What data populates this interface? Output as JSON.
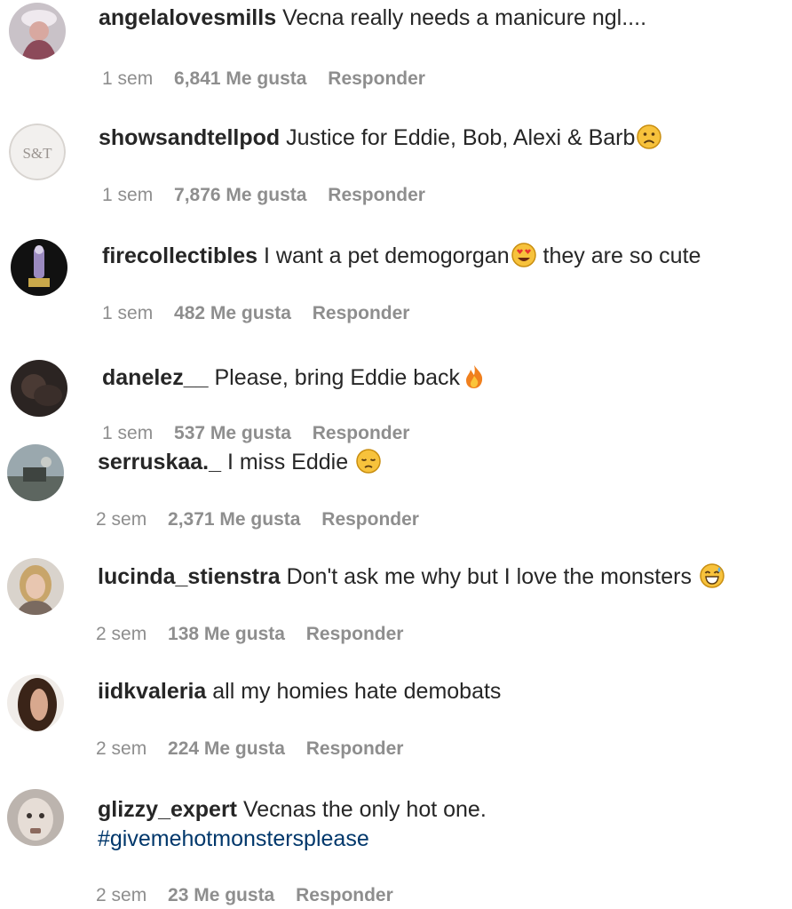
{
  "comments": [
    {
      "username": "angelalovesmills",
      "text": "Vecna really needs a manicure ngl....",
      "time": "1 sem",
      "likes": "6,841 Me gusta",
      "reply": "Responder",
      "avatar": "avatar-person-hat"
    },
    {
      "username": "showsandtellpod",
      "text": "Justice for Eddie, Bob, Alexi & Barb",
      "emoji": "sad-face-emoji",
      "time": "1 sem",
      "likes": "7,876 Me gusta",
      "reply": "Responder",
      "avatar": "avatar-logo",
      "avatar_text": "S&T"
    },
    {
      "username": "firecollectibles",
      "text_before": "I want a pet demogorgan",
      "emoji": "heart-eyes-emoji",
      "text_after": " they are so cute",
      "time": "1 sem",
      "likes": "482 Me gusta",
      "reply": "Responder",
      "avatar": "avatar-figure"
    },
    {
      "username": "danelez__",
      "text": "Please, bring Eddie back",
      "emoji": "fire-emoji",
      "time": "1 sem",
      "likes": "537 Me gusta",
      "reply": "Responder",
      "avatar": "avatar-dark"
    },
    {
      "username": "serruskaa._",
      "text": "I miss Eddie ",
      "emoji": "pensive-face-emoji",
      "time": "2 sem",
      "likes": "2,371 Me gusta",
      "reply": "Responder",
      "avatar": "avatar-outdoor"
    },
    {
      "username": "lucinda_stienstra",
      "text": "Don't ask me why but I love the monsters ",
      "emoji": "grinning-sweat-emoji",
      "time": "2 sem",
      "likes": "138 Me gusta",
      "reply": "Responder",
      "avatar": "avatar-blonde"
    },
    {
      "username": "iidkvaleria",
      "text": "all my homies hate demobats",
      "time": "2 sem",
      "likes": "224 Me gusta",
      "reply": "Responder",
      "avatar": "avatar-hair"
    },
    {
      "username": "glizzy_expert",
      "text": "Vecnas the only hot one.",
      "hashtag": "#givemehotmonstersplease",
      "time": "2 sem",
      "likes": "23 Me gusta",
      "reply": "Responder",
      "avatar": "avatar-pale"
    }
  ],
  "colors": {
    "text": "#262626",
    "meta": "#8e8e8e",
    "hashtag": "#00376b"
  }
}
